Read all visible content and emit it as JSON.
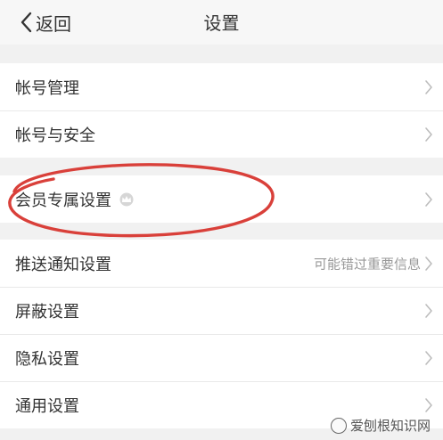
{
  "nav": {
    "back_label": "返回",
    "title": "设置"
  },
  "groups": [
    {
      "items": [
        {
          "label": "帐号管理"
        },
        {
          "label": "帐号与安全"
        }
      ]
    },
    {
      "items": [
        {
          "label": "会员专属设置",
          "icon": "crown-icon"
        }
      ]
    },
    {
      "items": [
        {
          "label": "推送通知设置",
          "hint": "可能错过重要信息"
        },
        {
          "label": "屏蔽设置"
        },
        {
          "label": "隐私设置"
        },
        {
          "label": "通用设置"
        }
      ]
    }
  ],
  "watermark": {
    "text": "爱刨根知识网"
  },
  "colors": {
    "background": "#f1f1f1",
    "row": "#ffffff",
    "text": "#333333",
    "hint": "#999999",
    "annotation": "#d9403a"
  }
}
